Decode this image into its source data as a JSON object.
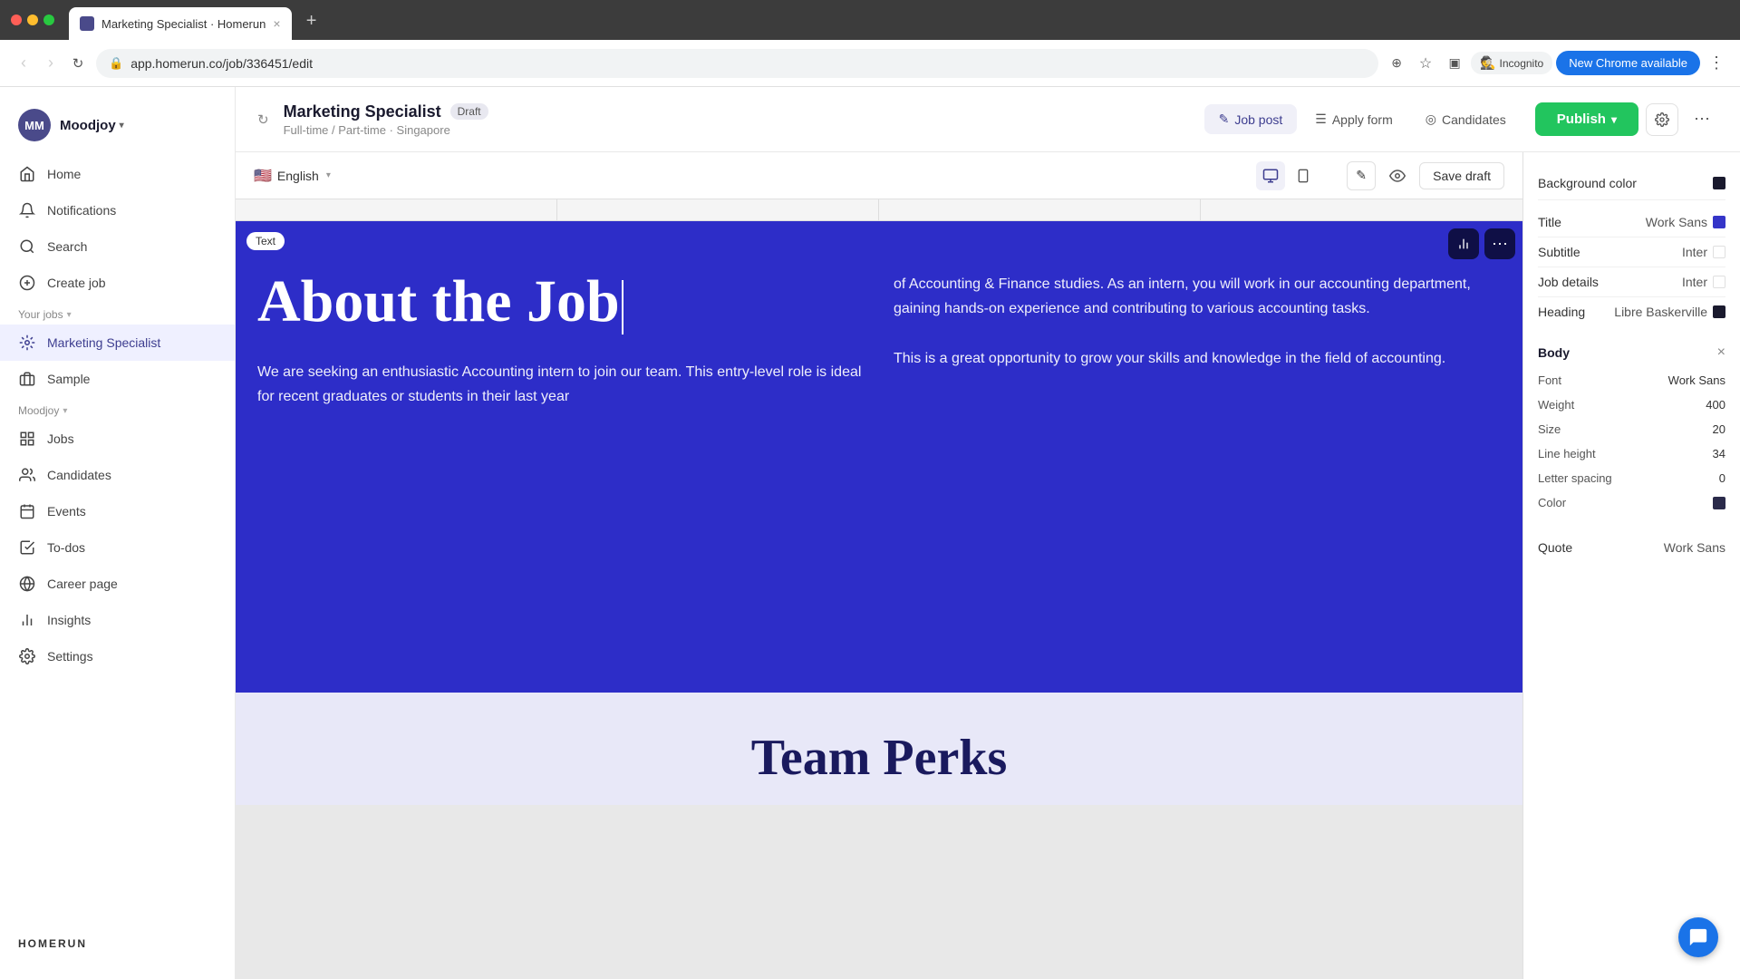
{
  "browser": {
    "tab_title": "Marketing Specialist · Homerun",
    "address": "app.homerun.co/job/336451/edit",
    "new_chrome_label": "New Chrome available",
    "incognito_label": "Incognito"
  },
  "header": {
    "job_title": "Marketing Specialist",
    "draft_badge": "Draft",
    "job_meta": "Full-time / Part-time · Singapore",
    "tabs": [
      {
        "label": "Job post",
        "icon": "✎"
      },
      {
        "label": "Apply form",
        "icon": "☰"
      },
      {
        "label": "Candidates",
        "icon": "◎"
      }
    ],
    "publish_label": "Publish",
    "settings_icon": "⚙",
    "more_icon": "⋯"
  },
  "sidebar": {
    "org_name": "Moodjoy",
    "avatar_initials": "MM",
    "nav_items": [
      {
        "label": "Home",
        "icon": "home"
      },
      {
        "label": "Notifications",
        "icon": "bell"
      },
      {
        "label": "Search",
        "icon": "search"
      },
      {
        "label": "Create job",
        "icon": "plus"
      }
    ],
    "your_jobs_label": "Your jobs",
    "jobs": [
      {
        "label": "Marketing Specialist",
        "icon": "job",
        "active": true
      },
      {
        "label": "Sample",
        "icon": "bag"
      }
    ],
    "org_label": "Moodjoy",
    "org_items": [
      {
        "label": "Jobs",
        "icon": "grid"
      },
      {
        "label": "Candidates",
        "icon": "people"
      },
      {
        "label": "Events",
        "icon": "calendar"
      },
      {
        "label": "To-dos",
        "icon": "check"
      },
      {
        "label": "Career page",
        "icon": "globe"
      },
      {
        "label": "Insights",
        "icon": "chart"
      },
      {
        "label": "Settings",
        "icon": "gear"
      }
    ],
    "logo": "HOMERUN"
  },
  "canvas": {
    "language": "English",
    "flag": "🇺🇸",
    "save_draft_label": "Save draft",
    "text_tag": "Text",
    "heading": "About the Job",
    "body_left": "We are seeking an enthusiastic Accounting intern to join our team. This entry-level role is ideal for recent graduates or students in their last year",
    "body_right_1": "of Accounting & Finance studies. As an intern, you will work in our accounting department, gaining hands-on experience and contributing to various accounting tasks.",
    "body_right_2": "This is a great opportunity to grow your skills and knowledge in the field of accounting.",
    "team_perks": "Team Perks"
  },
  "right_panel": {
    "bg_color_label": "Background color",
    "title_row": {
      "label": "Title",
      "value": "Work Sans"
    },
    "subtitle_row": {
      "label": "Subtitle",
      "value": "Inter"
    },
    "job_details_row": {
      "label": "Job details",
      "value": "Inter"
    },
    "heading_row": {
      "label": "Heading",
      "value": "Libre Baskerville"
    },
    "body_section": {
      "title": "Body",
      "font_label": "Font",
      "font_value": "Work Sans",
      "weight_label": "Weight",
      "weight_value": "400",
      "size_label": "Size",
      "size_value": "20",
      "line_height_label": "Line height",
      "line_height_value": "34",
      "letter_spacing_label": "Letter spacing",
      "letter_spacing_value": "0",
      "color_label": "Color"
    },
    "quote_row": {
      "label": "Quote",
      "value": "Work Sans"
    }
  }
}
